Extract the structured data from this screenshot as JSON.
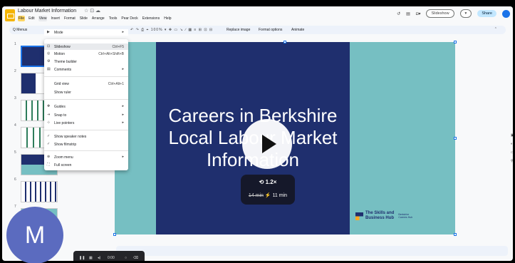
{
  "doc": {
    "title": "Labour Market Information",
    "title_icons": "☆ ⊡ ☁"
  },
  "menubar": [
    "File",
    "Edit",
    "View",
    "Insert",
    "Format",
    "Slide",
    "Arrange",
    "Tools",
    "Pear Deck",
    "Extensions",
    "Help"
  ],
  "header_right": {
    "history_icon": "↺",
    "comment_icon": "▤",
    "camera_icon": "◘▾",
    "slideshow_label": "Slideshow",
    "dropdown_icon": "▾",
    "share_label": "Share"
  },
  "toolbar": {
    "menus_label": "Q Menus",
    "tools_glyphs": "↶ ↷ ⎙ ⌖ 100% ▾ ✥ ▭ ↘ ∕ ▦ ≡ ⊞ ⊡ ⊟",
    "replace_image": "Replace image",
    "format_options": "Format options",
    "animate": "Animate",
    "collapse_icon": "⌃"
  },
  "thumb_numbers": [
    "1",
    "2",
    "3",
    "4",
    "5",
    "6",
    "7"
  ],
  "view_menu": {
    "items": [
      {
        "icon": "▶",
        "label": "Mode",
        "shortcut": "",
        "arrow": "▸"
      },
      {
        "icon": "⊡",
        "label": "Slideshow",
        "shortcut": "Ctrl+F5",
        "arrow": ""
      },
      {
        "icon": "◎",
        "label": "Motion",
        "shortcut": "Ctrl+Alt+Shift+B",
        "arrow": ""
      },
      {
        "icon": "⚙",
        "label": "Theme builder",
        "shortcut": "",
        "arrow": ""
      },
      {
        "icon": "▤",
        "label": "Comments",
        "shortcut": "",
        "arrow": "▸"
      },
      {
        "icon": "",
        "label": "Grid view",
        "shortcut": "Ctrl+Alt+1",
        "arrow": ""
      },
      {
        "icon": "",
        "label": "Show ruler",
        "shortcut": "",
        "arrow": ""
      },
      {
        "icon": "✥",
        "label": "Guides",
        "shortcut": "",
        "arrow": "▸"
      },
      {
        "icon": "⇥",
        "label": "Snap to",
        "shortcut": "",
        "arrow": "▸"
      },
      {
        "icon": "⊹",
        "label": "Live pointers",
        "shortcut": "",
        "arrow": "▸"
      },
      {
        "icon": "✓",
        "label": "Show speaker notes",
        "shortcut": "",
        "arrow": ""
      },
      {
        "icon": "✓",
        "label": "Show filmstrip",
        "shortcut": "",
        "arrow": ""
      },
      {
        "icon": "⊕",
        "label": "Zoom menu",
        "shortcut": "",
        "arrow": "▸"
      },
      {
        "icon": "⛶",
        "label": "Full screen",
        "shortcut": "",
        "arrow": ""
      }
    ]
  },
  "slide": {
    "title": "Careers in Berkshire Local Labour Market Information",
    "logo_text_1": "The Skills and",
    "logo_text_2": "Business Hub",
    "logo_small_1": "Berkshire",
    "logo_small_2": "Careers Hub"
  },
  "player": {
    "speed": "⟲ 1.2×",
    "time_old": "14 min",
    "time_new": "11 min",
    "bolt": "⚡",
    "bar_time": "0:00"
  },
  "avatar_letter": "M",
  "right_rail": [
    "▣",
    "◐",
    "▭",
    "⚲"
  ]
}
